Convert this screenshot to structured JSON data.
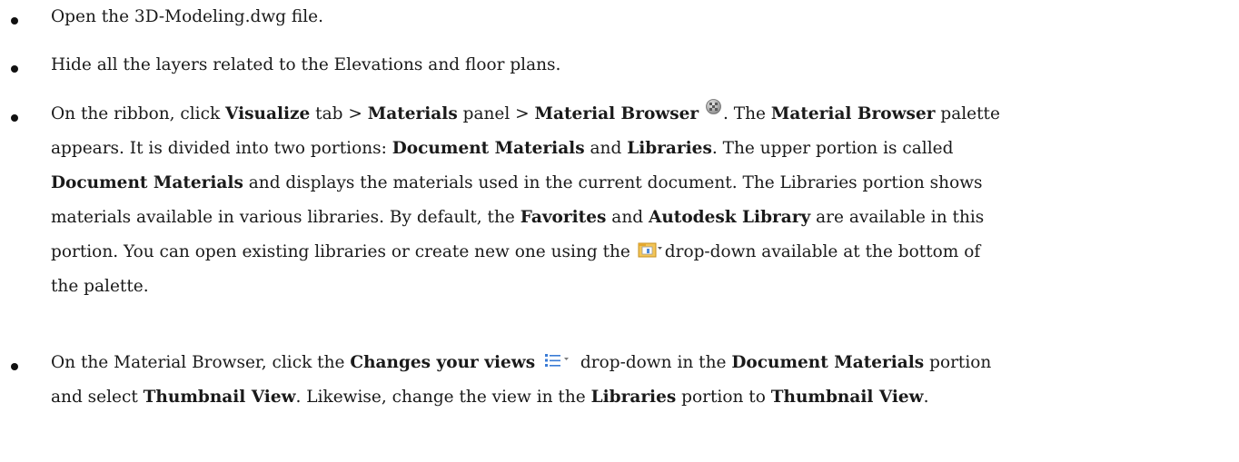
{
  "items": [
    {
      "text": "Open the 3D-Modeling.dwg file."
    },
    {
      "text": "Hide all the layers related to the Elevations and floor plans."
    },
    {
      "p1": "On the ribbon, click ",
      "b1": "Visualize",
      "p2": " tab > ",
      "b2": "Materials",
      "p3": " panel > ",
      "b3": "Material Browser",
      "icon1": "material-browser-icon",
      "p4": ". The ",
      "b4": "Material Browser",
      "p5": " palette",
      "p6": "appears. It is divided into two portions: ",
      "b5": "Document Materials",
      "p7": " and ",
      "b6": "Libraries",
      "p8": ". The upper portion is called",
      "b7": "Document Materials",
      "p9": " and displays the materials used in the current document. The Libraries portion shows",
      "p10": "materials available in various libraries. By default, the ",
      "b8": "Favorites",
      "p11": " and ",
      "b9": "Autodesk Library",
      "p12": " are available in this",
      "p13": "portion. You can open existing libraries or create new one using the ",
      "icon2": "library-dropdown-icon",
      "p14": "drop-down available at the bottom of",
      "p15": "the palette."
    },
    {
      "p1": "On the Material Browser, click the ",
      "b1": "Changes your views",
      "icon1": "list-view-dropdown-icon",
      "p2": " drop-down in the ",
      "b2": "Document Materials",
      "p3": " portion",
      "p4": "and select ",
      "b3": "Thumbnail View",
      "p5": ". Likewise, change the view in the ",
      "b4": "Libraries",
      "p6": " portion to ",
      "b5": "Thumbnail View",
      "p7": "."
    }
  ],
  "colors": {
    "text": "#1a1a1a",
    "icon_folder": "#e8b13a",
    "icon_list": "#3a7bd5"
  }
}
